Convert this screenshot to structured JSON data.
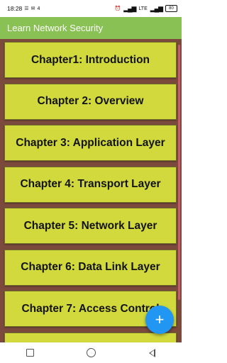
{
  "status_bar": {
    "time": "18:28",
    "extra": "4",
    "network": "LTE",
    "battery": "80"
  },
  "app_bar": {
    "title": "Learn Network Security"
  },
  "chapters": [
    "Chapter1: Introduction",
    "Chapter 2: Overview",
    "Chapter 3: Application Layer",
    "Chapter 4: Transport Layer",
    "Chapter 5: Network Layer",
    "Chapter 6: Data Link Layer",
    "Chapter 7: Access Control",
    ""
  ],
  "fab": {
    "icon": "plus-icon",
    "symbol": "+"
  },
  "colors": {
    "app_bar": "#89c155",
    "background": "#7b4a3c",
    "card": "#d1d93d",
    "fab": "#2196f3"
  }
}
